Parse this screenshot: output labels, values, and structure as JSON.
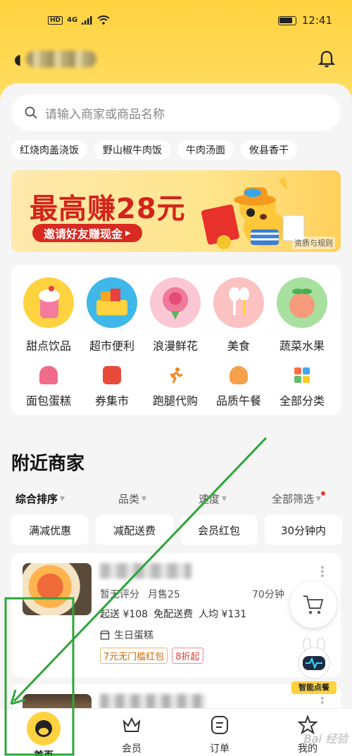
{
  "status_bar": {
    "network": "4G",
    "hd": "HD",
    "time": "12:41"
  },
  "search": {
    "placeholder": "请输入商家或商品名称"
  },
  "hot_tags": [
    "红烧肉盖浇饭",
    "野山椒牛肉饭",
    "牛肉汤面",
    "攸县香干"
  ],
  "banner": {
    "title": "最高赚28元",
    "button": "邀请好友赚现金",
    "note": "资质与规则"
  },
  "categories_main": [
    {
      "label": "甜点饮品",
      "icon": "dessert-drink-icon"
    },
    {
      "label": "超市便利",
      "icon": "supermarket-basket-icon"
    },
    {
      "label": "浪漫鲜花",
      "icon": "rose-flower-icon"
    },
    {
      "label": "美食",
      "icon": "food-cutlery-icon"
    },
    {
      "label": "蔬菜水果",
      "icon": "peach-fruit-icon"
    }
  ],
  "categories_minor": [
    {
      "label": "面包蛋糕",
      "icon": "cake-icon"
    },
    {
      "label": "券集市",
      "icon": "coupon-icon"
    },
    {
      "label": "跑腿代购",
      "icon": "runner-icon"
    },
    {
      "label": "品质午餐",
      "icon": "lunch-bowl-icon"
    },
    {
      "label": "全部分类",
      "icon": "grid-icon"
    }
  ],
  "section": {
    "title": "附近商家"
  },
  "sort": [
    "综合排序",
    "品类",
    "速度",
    "全部筛选"
  ],
  "filters": [
    "满减优惠",
    "减配送费",
    "会员红包",
    "30分钟内"
  ],
  "shop": {
    "rating": "暂无评分",
    "monthly_sales": "月售25",
    "delivery_time": "70分钟",
    "min_order": "起送 ¥108",
    "delivery_fee": "免配送费",
    "avg_price": "人均 ¥131",
    "category": "生日蛋糕",
    "coupon_1": "7元无门槛红包",
    "coupon_2": "8折起"
  },
  "floating": {
    "robot_label": "智能点餐"
  },
  "tabbar": [
    "首页",
    "会员",
    "订单",
    "我的"
  ],
  "watermark": "Bai 经验",
  "colors": {
    "brand_yellow": "#ffd23f",
    "annotation_green": "#2ea43a",
    "banner_red": "#d3231b"
  }
}
